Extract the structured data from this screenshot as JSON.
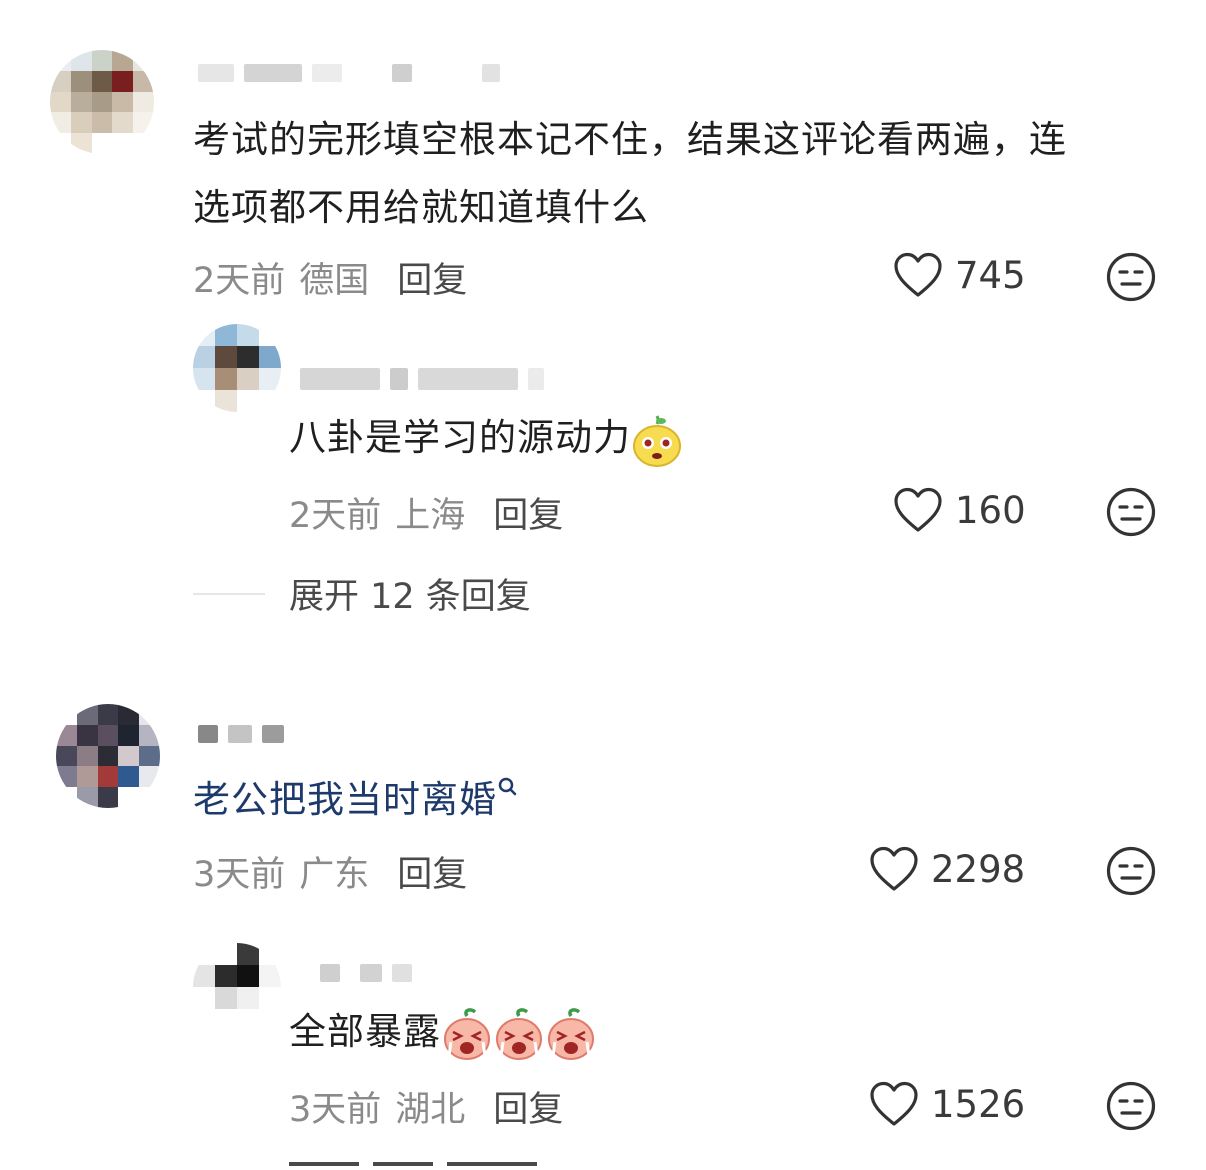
{
  "comments": [
    {
      "text": "考试的完形填空根本记不住，结果这评论看两遍，连选项都不用给就知道填什么",
      "line1": "考试的完形填空根本记不住，结果这评论看两遍，连",
      "line2": "选项都不用给就知道填什么",
      "time": "2天前",
      "location": "德国",
      "reply_label": "回复",
      "likes": "745",
      "replies": [
        {
          "text": "八卦是学习的源动力",
          "emoji": "yellow-face-emoji",
          "time": "2天前",
          "location": "上海",
          "reply_label": "回复",
          "likes": "160"
        }
      ],
      "expand_label": "展开 12 条回复"
    },
    {
      "text": "老公把我当时离婚",
      "search_icon": "search-icon",
      "time": "3天前",
      "location": "广东",
      "reply_label": "回复",
      "likes": "2298",
      "replies": [
        {
          "text": "全部暴露",
          "emoji": "crying-peach-emoji",
          "emoji_count": 3,
          "time": "3天前",
          "location": "湖北",
          "reply_label": "回复",
          "likes": "1526"
        }
      ]
    }
  ],
  "colors": {
    "text": "#1f1f1f",
    "meta": "#8a8a8a",
    "link": "#1d3a6b"
  }
}
